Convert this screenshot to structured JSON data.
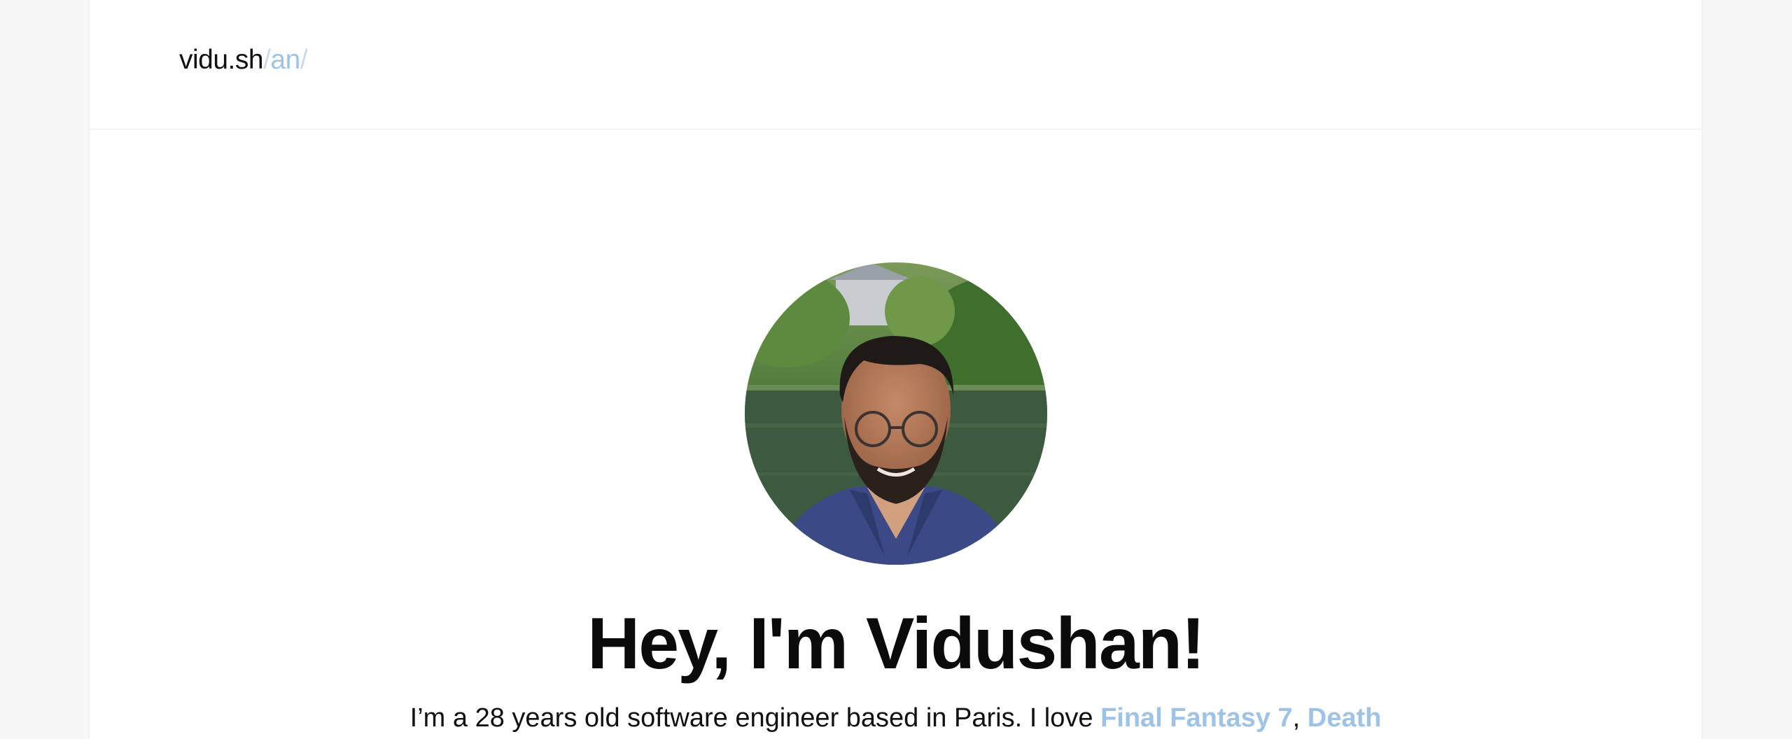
{
  "header": {
    "logo_main": "vidu.sh",
    "logo_slash1": "/",
    "logo_accent": "an",
    "logo_slash2": "/"
  },
  "hero": {
    "avatar_alt": "Portrait of Vidushan",
    "title": "Hey, I'm Vidushan!",
    "intro_text": "I’m a 28 years old software engineer based in Paris. I love ",
    "link_ff7": "Final Fantasy 7",
    "separator": ", ",
    "link_death": "Death"
  },
  "colors": {
    "accent": "#9ec3e6",
    "text": "#111111",
    "background": "#ffffff",
    "outer_background": "#f7f7f7"
  }
}
